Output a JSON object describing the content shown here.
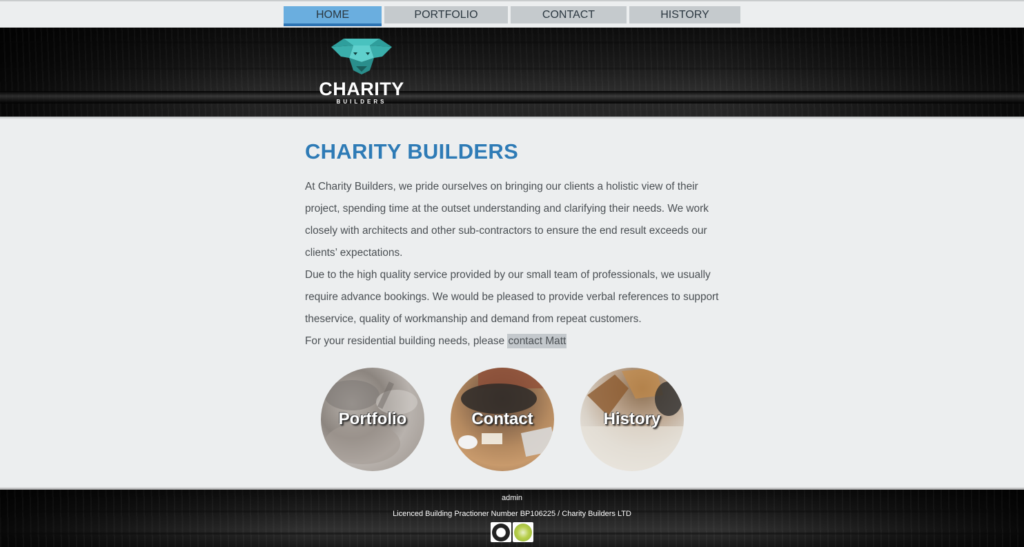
{
  "nav": {
    "items": [
      {
        "label": "HOME",
        "active": true
      },
      {
        "label": "PORTFOLIO",
        "active": false
      },
      {
        "label": "CONTACT",
        "active": false
      },
      {
        "label": "HISTORY",
        "active": false
      }
    ]
  },
  "header": {
    "logo_word": "CHARITY",
    "logo_sub": "BUILDERS",
    "logo_icon": "dog-head-icon",
    "logo_color": "#3fb3b0"
  },
  "main": {
    "title": "CHARITY BUILDERS",
    "paragraph1": "At Charity Builders, we pride ourselves on bringing our clients a holistic view of their project, spending time at the outset understanding and clarifying their needs. We work closely with architects and other sub-contractors to ensure the end result exceeds our clients’ expectations.",
    "paragraph2": "Due to the high quality service provided by our small team of professionals, we usually require advance bookings. We would be pleased to provide verbal references to support theservice, quality of workmanship and demand from repeat customers.",
    "paragraph3_prefix": "For your residential building needs, please ",
    "contact_link": "contact Matt",
    "title_color": "#2e7bb6"
  },
  "circles": [
    {
      "label": "Portfolio"
    },
    {
      "label": "Contact"
    },
    {
      "label": "History"
    }
  ],
  "footer": {
    "admin": "admin",
    "licence": "Licenced Building Practioner Number BP106225 / Charity Builders LTD",
    "badges": [
      "master-builders-badge-icon",
      "green-certification-badge-icon"
    ]
  }
}
